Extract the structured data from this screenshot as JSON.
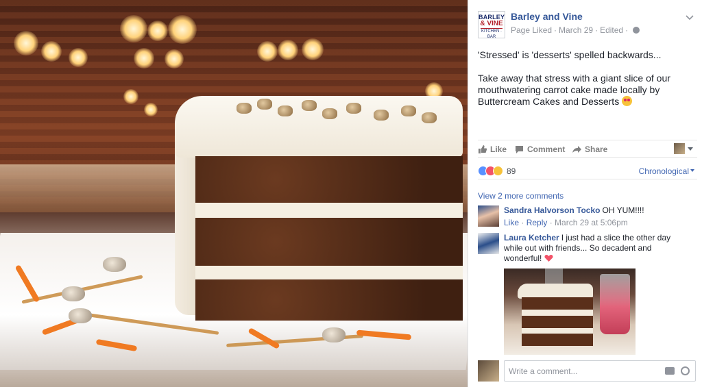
{
  "post": {
    "page_name": "Barley and Vine",
    "logo_line1": "BARLEY",
    "logo_line2": "& VINE",
    "logo_line3": "KITCHEN · BAR",
    "meta_liked": "Page Liked",
    "meta_date": "March 29",
    "meta_edited": "Edited",
    "text_p1": "'Stressed' is 'desserts' spelled backwards...",
    "text_p2": "Take away that stress with a giant slice of our mouthwatering carrot cake made locally by Buttercream Cakes and Desserts"
  },
  "actions": {
    "like": "Like",
    "comment": "Comment",
    "share": "Share"
  },
  "reactions": {
    "count": "89",
    "sort_label": "Chronological"
  },
  "comments": {
    "view_more": "View 2 more comments",
    "items": [
      {
        "name": "Sandra Halvorson Tocko",
        "text": "OH YUM!!!!",
        "like": "Like",
        "reply": "Reply",
        "timestamp": "March 29 at 5:06pm"
      },
      {
        "name": "Laura Ketcher",
        "text": "I just had a slice the other day while out with friends... So decadent and wonderful!"
      }
    ]
  },
  "composer": {
    "placeholder": "Write a comment..."
  },
  "colors": {
    "link": "#365899",
    "accent": "#4267b2",
    "muted": "#90949c"
  }
}
